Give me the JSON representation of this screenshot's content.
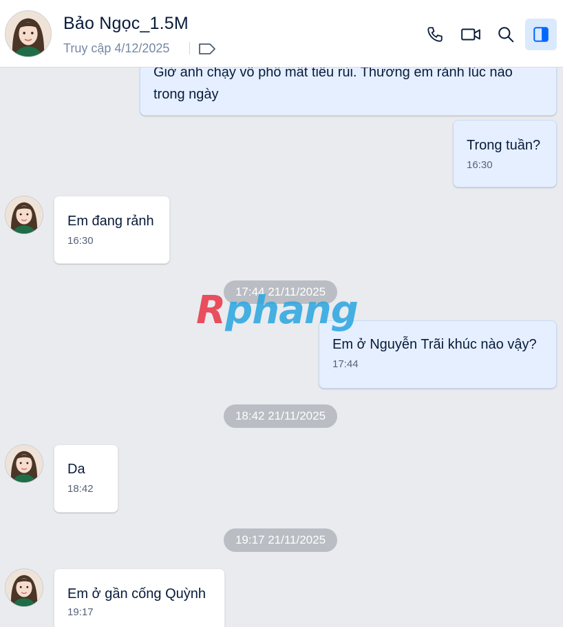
{
  "header": {
    "contact_name": "Bảo Ngọc_1.5M",
    "last_seen": "Truy cập 4/12/2025",
    "icons": [
      "avatar",
      "tag-icon",
      "phone-icon",
      "video-call-icon",
      "search-icon",
      "side-panel-icon"
    ]
  },
  "messages": [
    {
      "side": "sent",
      "text_line1": "Giờ anh chạy vô phố mất tiêu rùi. Thương em rảnh lúc nào",
      "text_line2": "trong ngày"
    },
    {
      "side": "sent",
      "text": "Trong tuần?",
      "time": "16:30"
    },
    {
      "side": "received",
      "text": "Em đang rảnh",
      "time": "16:30"
    },
    {
      "side": "sent",
      "text": "Em ở Nguyễn Trãi khúc nào vậy?",
      "time": "17:44"
    },
    {
      "side": "received",
      "text": "Da",
      "time": "18:42"
    },
    {
      "side": "received",
      "text": "Em ở gần cống Quỳnh",
      "time": "19:17"
    }
  ],
  "date_separators": [
    "17:44 21/11/2025",
    "18:42 21/11/2025",
    "19:17 21/11/2025"
  ],
  "watermark": {
    "first_letter": "R",
    "rest": "phang"
  },
  "colors": {
    "sent_bubble": "#e5efff",
    "received_bubble": "#ffffff",
    "chat_background": "#e9ebef",
    "date_pill": "#babdc3",
    "accent": "#0068ff"
  }
}
